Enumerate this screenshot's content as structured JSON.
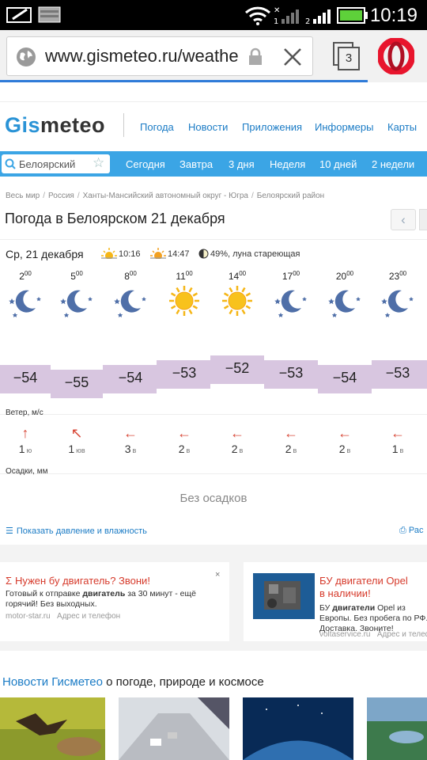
{
  "status": {
    "time": "10:19"
  },
  "browser": {
    "url": "www.gismeteo.ru/weathe",
    "tab_count": "3"
  },
  "site": {
    "logo_part1": "Gis",
    "logo_part2": "meteo",
    "nav": [
      "Погода",
      "Новости",
      "Приложения",
      "Информеры",
      "Карты"
    ]
  },
  "tabs": {
    "city": "Белоярский",
    "items": [
      "Сегодня",
      "Завтра",
      "3 дня",
      "Неделя",
      "10 дней",
      "2 недели"
    ]
  },
  "breadcrumb": [
    "Весь мир",
    "Россия",
    "Ханты-Мансийский автономный округ - Югра",
    "Белоярский район"
  ],
  "page_title": "Погода в Белоярском 21 декабря",
  "day": {
    "label": "Ср, 21 декабря",
    "sunrise": "10:16",
    "sunset": "14:47",
    "moon": "49%, луна стареющая"
  },
  "forecast": {
    "hours": [
      {
        "h": "2",
        "m": "00"
      },
      {
        "h": "5",
        "m": "00"
      },
      {
        "h": "8",
        "m": "00"
      },
      {
        "h": "11",
        "m": "00"
      },
      {
        "h": "14",
        "m": "00"
      },
      {
        "h": "17",
        "m": "00"
      },
      {
        "h": "20",
        "m": "00"
      },
      {
        "h": "23",
        "m": "00"
      }
    ],
    "icons": [
      "moon-icon",
      "moon-icon",
      "moon-icon",
      "sun-icon",
      "sun-icon",
      "moon-icon",
      "moon-icon",
      "moon-icon"
    ],
    "temps": [
      "−54",
      "−55",
      "−54",
      "−53",
      "−52",
      "−53",
      "−54",
      "−53"
    ],
    "temp_values": [
      -54,
      -55,
      -54,
      -53,
      -52,
      -53,
      -54,
      -53
    ],
    "wind_label": "Ветер, м/с",
    "wind": [
      {
        "speed": "1",
        "dir": "ю",
        "arrow": "↑"
      },
      {
        "speed": "1",
        "dir": "юв",
        "arrow": "↖"
      },
      {
        "speed": "3",
        "dir": "в",
        "arrow": "←"
      },
      {
        "speed": "2",
        "dir": "в",
        "arrow": "←"
      },
      {
        "speed": "2",
        "dir": "в",
        "arrow": "←"
      },
      {
        "speed": "2",
        "dir": "в",
        "arrow": "←"
      },
      {
        "speed": "2",
        "dir": "в",
        "arrow": "←"
      },
      {
        "speed": "1",
        "dir": "в",
        "arrow": "←"
      }
    ],
    "precip_label": "Осадки, мм",
    "precip_text": "Без осадков"
  },
  "links": {
    "show_pressure": "Показать давление и влажность",
    "print": "Рас"
  },
  "ads": [
    {
      "title": "Нужен бу двигатель? Звони!",
      "text_pre": "Готовый к отправке ",
      "text_bold": "двигатель",
      "text_post": " за 30 минут - ещё горячий! Без выходных.",
      "domain": "motor-star.ru",
      "link": "Адрес и телефон"
    },
    {
      "title_line1": "БУ двигатели Opel",
      "title_line2": "в наличии!",
      "text_pre": "БУ ",
      "text_bold": "двигатели",
      "text_post": " Opel из Европы. Без пробега по РФ. Доставка. Звоните!",
      "domain": "voltaservice.ru",
      "link": "Адрес и телефон"
    }
  ],
  "news": {
    "title_blue": "Новости Гисметео",
    "title_rest": " о погоде, природе и космосе"
  },
  "colors": {
    "accent": "#3ba5e5",
    "link": "#1a7bc5",
    "temp_band": "#d8c6e0",
    "arrow": "#d84a3a",
    "ad_title": "#d63a2b"
  }
}
